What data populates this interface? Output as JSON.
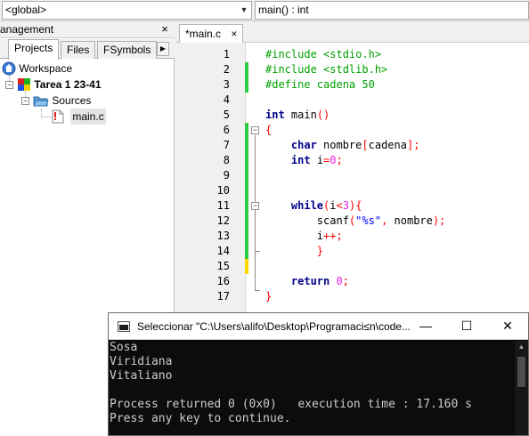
{
  "toolbar": {
    "scope_combo": "<global>",
    "function_combo": "main() : int"
  },
  "management": {
    "title": "Management",
    "close_glyph": "×",
    "tabs": [
      {
        "label": "Projects",
        "active": true
      },
      {
        "label": "Files",
        "active": false
      },
      {
        "label": "FSymbols",
        "active": false
      }
    ],
    "tree": {
      "workspace": "Workspace",
      "project": "Tarea 1 23-41",
      "folder": "Sources",
      "file": "main.c"
    }
  },
  "editor": {
    "tab_label": "*main.c",
    "tab_close": "×",
    "line_numbers": [
      "1",
      "2",
      "3",
      "4",
      "5",
      "6",
      "7",
      "8",
      "9",
      "10",
      "11",
      "12",
      "13",
      "14",
      "15",
      "16",
      "17"
    ],
    "changebar_colors": {
      "saved": "#2ecc40",
      "modified": "#ffd700"
    }
  },
  "console": {
    "title": "Seleccionar \"C:\\Users\\alifo\\Desktop\\Programaci≤n\\code...",
    "minimize": "—",
    "maximize": "☐",
    "close": "✕",
    "lines": [
      "Sosa",
      "Viridiana",
      "Vitaliano",
      "",
      "Process returned 0 (0x0)   execution time : 17.160 s",
      "Press any key to continue."
    ]
  },
  "icons": [
    "workspace-icon",
    "project-icon",
    "folder-icon",
    "file-icon",
    "console-app-icon"
  ]
}
